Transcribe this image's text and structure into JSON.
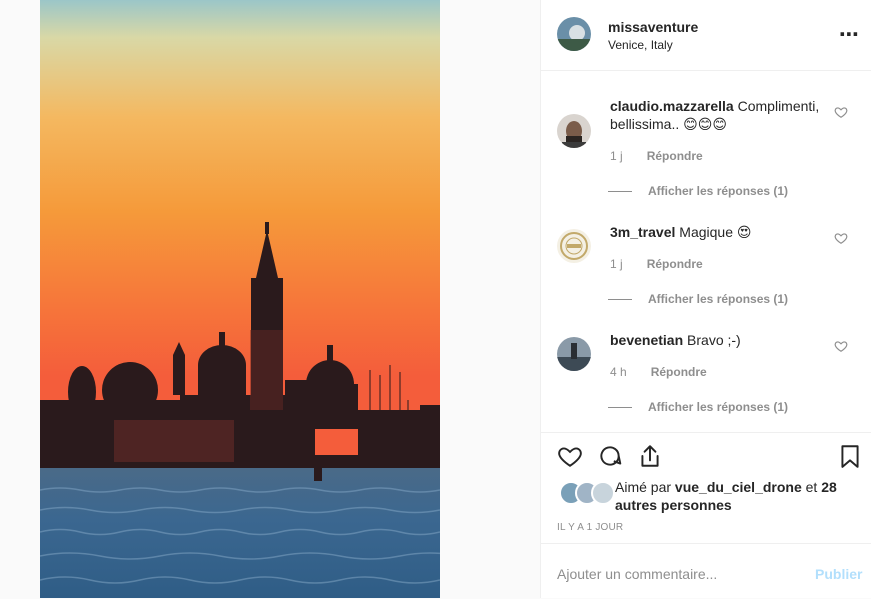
{
  "post": {
    "username": "missaventure",
    "location": "Venice, Italy",
    "more_icon": "⋯"
  },
  "comments": [
    {
      "username": "claudio.mazzarella",
      "text": "Complimenti, bellissima.. 😊😊😊",
      "age": "1 j",
      "reply_label": "Répondre",
      "replies_label": "Afficher les réponses (1)"
    },
    {
      "username": "3m_travel",
      "text": "Magique 😍",
      "age": "1 j",
      "reply_label": "Répondre",
      "replies_label": "Afficher les réponses (1)"
    },
    {
      "username": "bevenetian",
      "text": "Bravo ;-)",
      "age": "4 h",
      "reply_label": "Répondre",
      "replies_label": "Afficher les réponses (1)"
    }
  ],
  "likes": {
    "prefix": "Aimé par",
    "user": "vue_du_ciel_drone",
    "connector": "et",
    "others": "28 autres personnes"
  },
  "timestamp": "IL Y A 1 JOUR",
  "add_comment": {
    "placeholder": "Ajouter un commentaire...",
    "publish": "Publier"
  },
  "colors": {
    "accent_disabled": "#b2dffc",
    "secondary_text": "#8e8e8e",
    "border": "#efefef"
  },
  "icons": [
    "heart-icon",
    "comment-icon",
    "share-icon",
    "bookmark-icon",
    "more-icon"
  ]
}
